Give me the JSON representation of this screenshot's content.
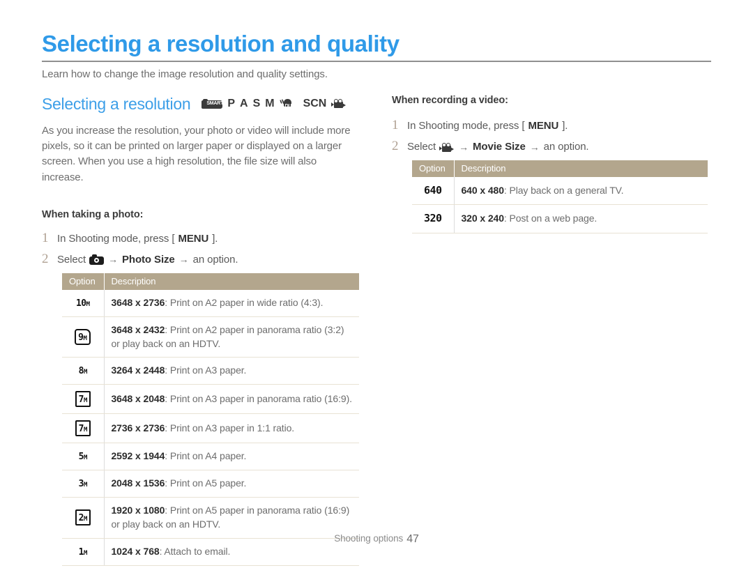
{
  "header": {
    "title": "Selecting a resolution and quality",
    "subtitle": "Learn how to change the image resolution and quality settings."
  },
  "left": {
    "section_title": "Selecting a resolution",
    "mode_icons": [
      "smart-camera",
      "P",
      "A",
      "S",
      "M",
      "DUAL",
      "SCN",
      "movie-camera"
    ],
    "mode_labels": {
      "p": "P",
      "a": "A",
      "s": "S",
      "m": "M",
      "scn": "SCN",
      "smart": "SMART",
      "dual": "DUAL"
    },
    "paragraph": "As you increase the resolution, your photo or video will include more pixels, so it can be printed on larger paper or displayed on a larger screen. When you use a high resolution, the file size will also increase.",
    "subhead": "When taking a photo:",
    "steps": [
      {
        "num": "1",
        "pre": "In Shooting mode, press [",
        "bold": "MENU",
        "post": "]."
      },
      {
        "num": "2",
        "pre": "Select",
        "icon": "camera-icon",
        "arrow1": "→",
        "bold": "Photo Size",
        "arrow2": "→",
        "post": "an option."
      }
    ],
    "table": {
      "columns": [
        "Option",
        "Description"
      ],
      "rows": [
        {
          "badge": "10",
          "badge_unit": "M",
          "badge_style": "plain",
          "value": "3648 x 2736",
          "desc": ": Print on A2 paper in wide ratio (4:3)."
        },
        {
          "badge": "9",
          "badge_unit": "M",
          "badge_style": "pan",
          "value": "3648 x 2432",
          "desc": ": Print on A2 paper in panorama ratio (3:2) or play back on an HDTV."
        },
        {
          "badge": "8",
          "badge_unit": "M",
          "badge_style": "plain",
          "value": "3264 x 2448",
          "desc": ": Print on A3 paper."
        },
        {
          "badge": "7",
          "badge_unit": "M",
          "badge_style": "box-wide",
          "value": "3648 x 2048",
          "desc": ": Print on A3 paper in panorama ratio (16:9)."
        },
        {
          "badge": "7",
          "badge_unit": "M",
          "badge_style": "box",
          "value": "2736 x 2736",
          "desc": ": Print on A3 paper in 1:1 ratio."
        },
        {
          "badge": "5",
          "badge_unit": "M",
          "badge_style": "plain",
          "value": "2592 x 1944",
          "desc": ": Print on A4 paper."
        },
        {
          "badge": "3",
          "badge_unit": "M",
          "badge_style": "plain",
          "value": "2048 x 1536",
          "desc": ": Print on A5 paper."
        },
        {
          "badge": "2",
          "badge_unit": "M",
          "badge_style": "box-wide",
          "value": "1920 x 1080",
          "desc": ": Print on A5 paper in panorama ratio (16:9) or play back on an HDTV."
        },
        {
          "badge": "1",
          "badge_unit": "M",
          "badge_style": "plain",
          "value": "1024 x 768",
          "desc": ": Attach to email."
        }
      ]
    }
  },
  "right": {
    "subhead": "When recording a video:",
    "steps": [
      {
        "num": "1",
        "pre": "In Shooting mode, press [",
        "bold": "MENU",
        "post": "]."
      },
      {
        "num": "2",
        "pre": "Select",
        "icon": "movie-camera-icon",
        "arrow1": "→",
        "bold": "Movie Size",
        "arrow2": "→",
        "post": "an option."
      }
    ],
    "table": {
      "columns": [
        "Option",
        "Description"
      ],
      "rows": [
        {
          "badge": "640",
          "value": "640 x 480",
          "desc": ": Play back on a general TV."
        },
        {
          "badge": "320",
          "value": "320 x 240",
          "desc": ": Post on a web page."
        }
      ]
    }
  },
  "footer": {
    "label": "Shooting options",
    "page": "47"
  },
  "colors": {
    "title_blue": "#2f9ae8",
    "section_blue": "#3d9fe8",
    "table_header_tan": "#b3a68d",
    "step_number": "#b0a193",
    "body_gray": "#6d6d6d"
  }
}
